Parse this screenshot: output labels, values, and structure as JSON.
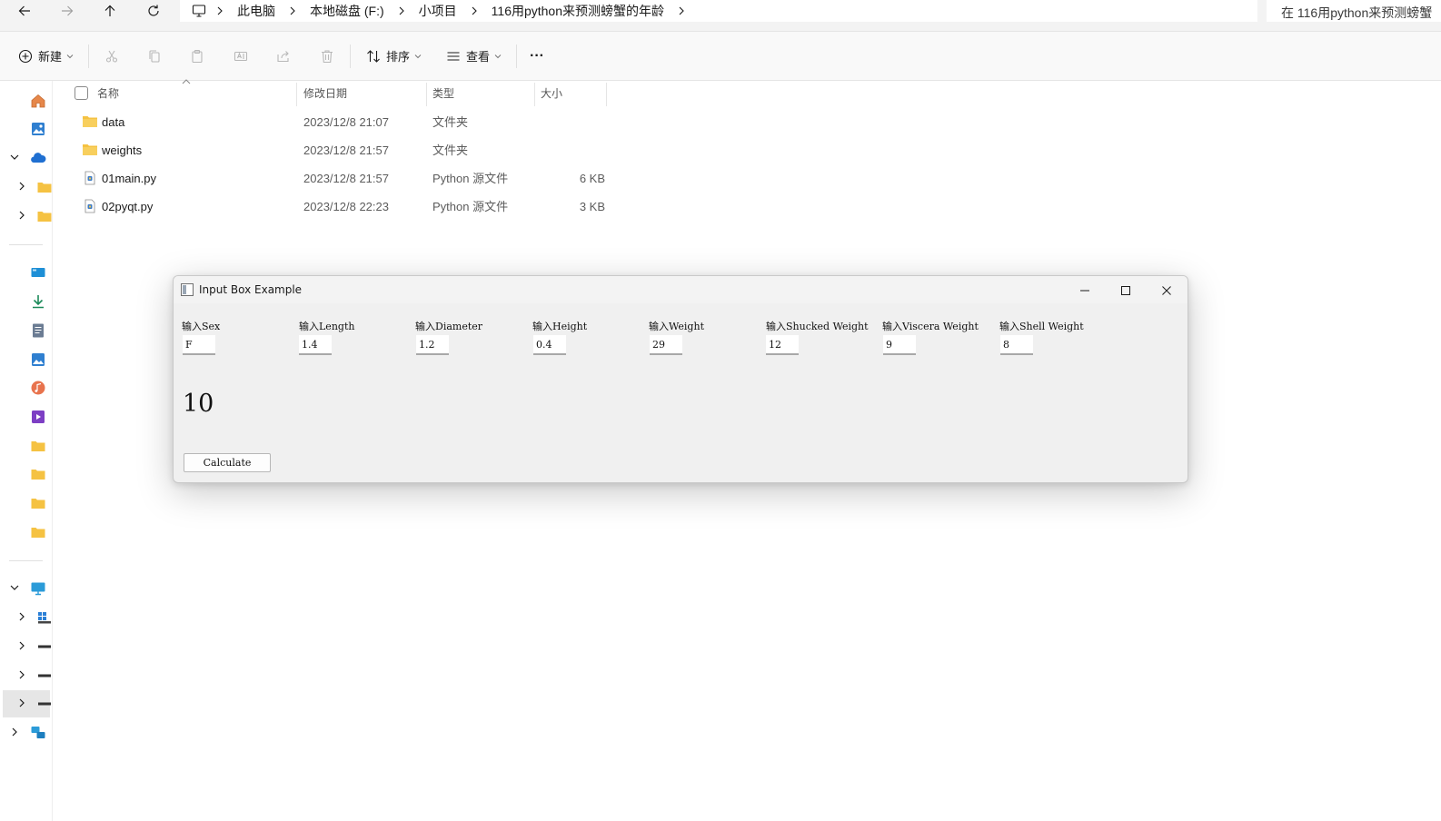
{
  "addressbar": {
    "crumbs": [
      "此电脑",
      "本地磁盘 (F:)",
      "小项目",
      "116用python来预测螃蟹的年龄"
    ],
    "search_placeholder": "在 116用python来预测螃蟹"
  },
  "toolbar": {
    "new_label": "新建",
    "sort_label": "排序",
    "view_label": "查看",
    "more_label": "···"
  },
  "filelist": {
    "headers": {
      "name": "名称",
      "date": "修改日期",
      "type": "类型",
      "size": "大小"
    },
    "rows": [
      {
        "name": "data",
        "date": "2023/12/8 21:07",
        "type": "文件夹",
        "size": "",
        "kind": "folder"
      },
      {
        "name": "weights",
        "date": "2023/12/8 21:57",
        "type": "文件夹",
        "size": "",
        "kind": "folder"
      },
      {
        "name": "01main.py",
        "date": "2023/12/8 21:57",
        "type": "Python 源文件",
        "size": "6 KB",
        "kind": "py"
      },
      {
        "name": "02pyqt.py",
        "date": "2023/12/8 22:23",
        "type": "Python 源文件",
        "size": "3 KB",
        "kind": "py"
      }
    ]
  },
  "dialog": {
    "title": "Input Box Example",
    "fields": [
      {
        "label": "输入Sex",
        "value": "F"
      },
      {
        "label": "输入Length",
        "value": "1.4"
      },
      {
        "label": "输入Diameter",
        "value": "1.2"
      },
      {
        "label": "输入Height",
        "value": "0.4"
      },
      {
        "label": "输入Weight",
        "value": "29"
      },
      {
        "label": "输入Shucked Weight",
        "value": "12"
      },
      {
        "label": "输入Viscera Weight",
        "value": "9"
      },
      {
        "label": "输入Shell Weight",
        "value": "8"
      }
    ],
    "result": "10",
    "calculate_label": "Calculate"
  },
  "colors": {
    "folder": "#f5c242",
    "accent": "#0067c0",
    "window_bg": "#f0f0f0"
  }
}
